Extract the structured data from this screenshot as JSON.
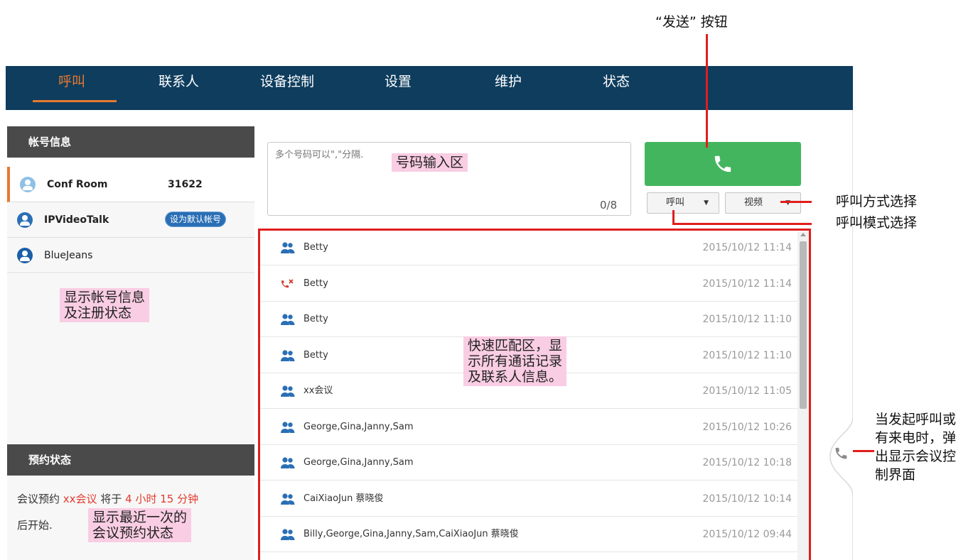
{
  "nav": {
    "items": [
      "呼叫",
      "联系人",
      "设备控制",
      "设置",
      "维护",
      "状态"
    ],
    "active": "呼叫"
  },
  "account_panel": {
    "title": "帐号信息",
    "accounts": [
      {
        "name": "Conf Room",
        "number": "31622"
      },
      {
        "name": "IPVideoTalk",
        "badge": "设为默认帐号"
      },
      {
        "name": "BlueJeans"
      }
    ]
  },
  "booking_panel": {
    "title": "预约状态",
    "prefix": "会议预约",
    "meeting": "xx会议",
    "mid": "将于",
    "countdown": "4 小时 15 分钟",
    "suffix": "后开始."
  },
  "dial": {
    "placeholder": "多个号码可以\",\"分隔.",
    "counter": "0/8",
    "call_mode_label": "呼叫",
    "call_type_label": "视频"
  },
  "call_list": [
    {
      "icon": "group-icon",
      "name": "Betty",
      "time": "2015/10/12 11:14"
    },
    {
      "icon": "missed-call-icon",
      "name": "Betty",
      "time": "2015/10/12 11:14"
    },
    {
      "icon": "group-icon",
      "name": "Betty",
      "time": "2015/10/12 11:10"
    },
    {
      "icon": "group-icon",
      "name": "Betty",
      "time": "2015/10/12 11:10"
    },
    {
      "icon": "group-icon",
      "name": "xx会议",
      "time": "2015/10/12 11:05"
    },
    {
      "icon": "group-icon",
      "name": "George,Gina,Janny,Sam",
      "time": "2015/10/12 10:26"
    },
    {
      "icon": "group-icon",
      "name": "George,Gina,Janny,Sam",
      "time": "2015/10/12 10:18"
    },
    {
      "icon": "group-icon",
      "name": "CaiXiaoJun 蔡晓俊",
      "time": "2015/10/12 10:14"
    },
    {
      "icon": "group-icon",
      "name": "Billy,George,Gina,Janny,Sam,CaiXiaoJun 蔡晓俊",
      "time": "2015/10/12 09:44"
    }
  ],
  "annotations": {
    "send_button": "“发送” 按钮",
    "number_input": "号码输入区",
    "call_type_select": "呼叫方式选择",
    "call_mode_select": "呼叫模式选择",
    "account_info": [
      "显示帐号信息",
      "及注册状态"
    ],
    "quick_match": [
      "快速匹配区，显",
      "示所有通话记录",
      "及联系人信息。"
    ],
    "recent_booking": [
      "显示最近一次的",
      "会议预约状态"
    ],
    "popup_control": [
      "当发起呼叫或",
      "有来电时，弹",
      "出显示会议控",
      "制界面"
    ]
  },
  "colors": {
    "nav_bg": "#0e3d5e",
    "accent": "#e8792f",
    "send_green": "#43b55e",
    "annotation_red": "#e11d1d",
    "annotation_pink": "#f9cde3"
  }
}
